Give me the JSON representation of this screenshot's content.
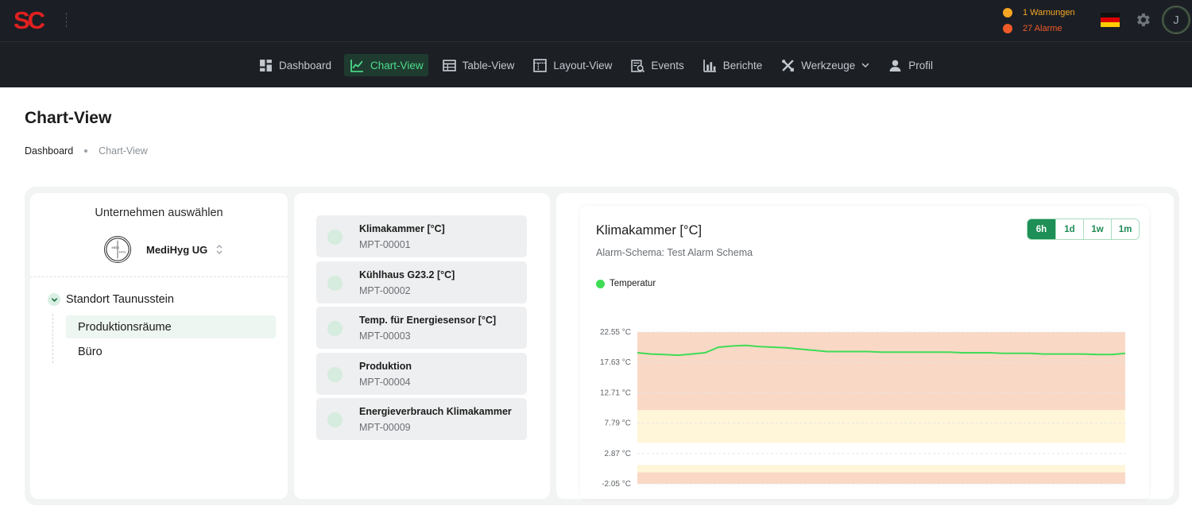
{
  "header": {
    "logo_text": "SC",
    "warnings_label": "1 Warnungen",
    "alarms_label": "27 Alarme",
    "warning_color": "#f5a623",
    "alarm_color": "#f05a28",
    "language_icon": "german-flag-icon",
    "settings_icon": "gear-icon",
    "avatar_initial": "J"
  },
  "nav": {
    "items": [
      {
        "label": "Dashboard",
        "icon": "dashboard-icon"
      },
      {
        "label": "Chart-View",
        "icon": "chart-line-icon",
        "active": true
      },
      {
        "label": "Table-View",
        "icon": "table-icon"
      },
      {
        "label": "Layout-View",
        "icon": "layout-icon"
      },
      {
        "label": "Events",
        "icon": "events-icon"
      },
      {
        "label": "Berichte",
        "icon": "bar-chart-icon"
      },
      {
        "label": "Werkzeuge",
        "icon": "tools-icon"
      },
      {
        "label": "Profil",
        "icon": "user-icon"
      }
    ],
    "active_color": "#4ede8e"
  },
  "page": {
    "title": "Chart-View",
    "breadcrumb": [
      "Dashboard",
      "Chart-View"
    ]
  },
  "company": {
    "label": "Unternehmen auswählen",
    "selected": "MediHyg UG",
    "logo_text": "MEDIHYG"
  },
  "tree": {
    "root": "Standort Taunusstein",
    "children": [
      {
        "label": "Produktionsräume",
        "selected": true
      },
      {
        "label": "Büro"
      }
    ]
  },
  "sensors": [
    {
      "name": "Klimakammer [°C]",
      "id": "MPT-00001"
    },
    {
      "name": "Kühlhaus G23.2 [°C]",
      "id": "MPT-00002"
    },
    {
      "name": "Temp. für Energiesensor [°C]",
      "id": "MPT-00003"
    },
    {
      "name": "Produktion",
      "id": "MPT-00004"
    },
    {
      "name": "Energieverbrauch Klimakammer",
      "id": "MPT-00009"
    }
  ],
  "chart": {
    "title": "Klimakammer [°C]",
    "subtitle": "Alarm-Schema: Test Alarm Schema",
    "ranges": [
      "6h",
      "1d",
      "1w",
      "1m"
    ],
    "active_range": "6h"
  },
  "chart_data": {
    "type": "line",
    "ylabel": "",
    "yticks": [
      "22.55 °C",
      "17.63 °C",
      "12.71 °C",
      "7.79 °C",
      "2.87 °C",
      "-2.05 °C"
    ],
    "ytick_values": [
      22.55,
      17.63,
      12.71,
      7.79,
      2.87,
      -2.05
    ],
    "ylim": [
      -2.05,
      22.55
    ],
    "series": [
      {
        "name": "Temperatur",
        "color": "#3fdc55",
        "x": [
          0,
          1,
          2,
          3,
          4,
          5,
          6,
          7,
          8,
          9,
          10,
          11,
          12,
          13,
          14,
          15,
          16,
          17,
          18,
          19,
          20,
          21,
          22,
          23,
          24,
          25,
          26,
          27,
          28,
          29,
          30,
          31,
          32,
          33,
          34,
          35,
          36
        ],
        "values": [
          19.2,
          19.0,
          18.9,
          18.8,
          19.0,
          19.2,
          20.1,
          20.3,
          20.4,
          20.2,
          20.1,
          20.0,
          19.8,
          19.6,
          19.4,
          19.4,
          19.4,
          19.4,
          19.3,
          19.3,
          19.3,
          19.3,
          19.3,
          19.3,
          19.2,
          19.2,
          19.2,
          19.1,
          19.1,
          19.1,
          19.0,
          19.0,
          19.0,
          19.0,
          18.9,
          18.9,
          19.1
        ]
      }
    ],
    "bands": [
      {
        "from": 9.9,
        "to": 22.55,
        "color": "#fad8c6"
      },
      {
        "from": 4.6,
        "to": 9.9,
        "color": "#fff5d9"
      },
      {
        "from": -0.2,
        "to": 1.0,
        "color": "#fff5d9"
      },
      {
        "from": -2.05,
        "to": -0.2,
        "color": "#fad8c6"
      }
    ]
  }
}
